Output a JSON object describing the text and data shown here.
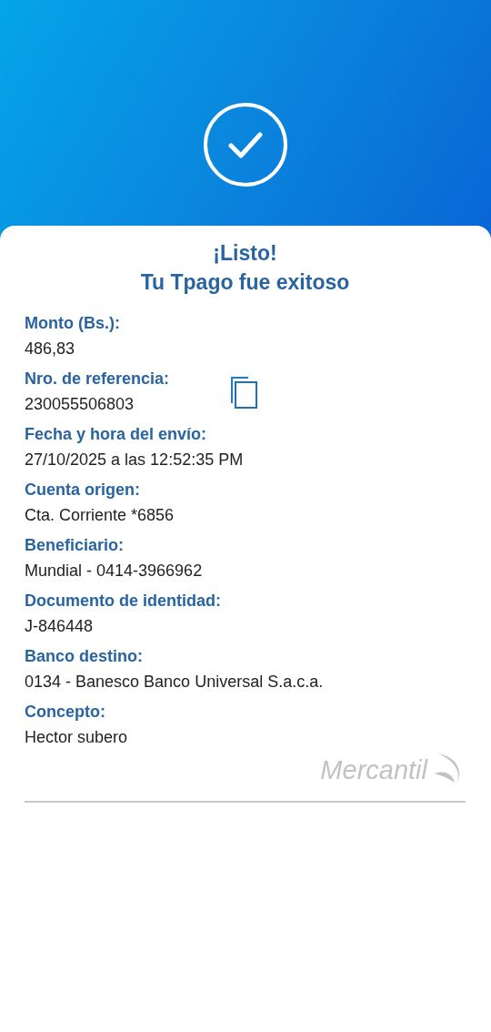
{
  "title": {
    "line1": "¡Listo!",
    "line2": "Tu Tpago fue exitoso"
  },
  "fields": [
    {
      "label": "Monto (Bs.):",
      "value": "486,83",
      "copy": false
    },
    {
      "label": "Nro. de referencia:",
      "value": "230055506803",
      "copy": true
    },
    {
      "label": "Fecha y hora del envío:",
      "value": "27/10/2025 a las 12:52:35 PM",
      "copy": false
    },
    {
      "label": "Cuenta origen:",
      "value": "Cta. Corriente *6856",
      "copy": false
    },
    {
      "label": "Beneficiario:",
      "value": "Mundial - 0414-3966962",
      "copy": false
    },
    {
      "label": "Documento de identidad:",
      "value": "J-846448",
      "copy": false
    },
    {
      "label": "Banco destino:",
      "value": "0134 - Banesco Banco Universal S.a.c.a.",
      "copy": false
    },
    {
      "label": "Concepto:",
      "value": "Hector subero",
      "copy": false
    }
  ],
  "logo": {
    "text": "Mercantil"
  }
}
